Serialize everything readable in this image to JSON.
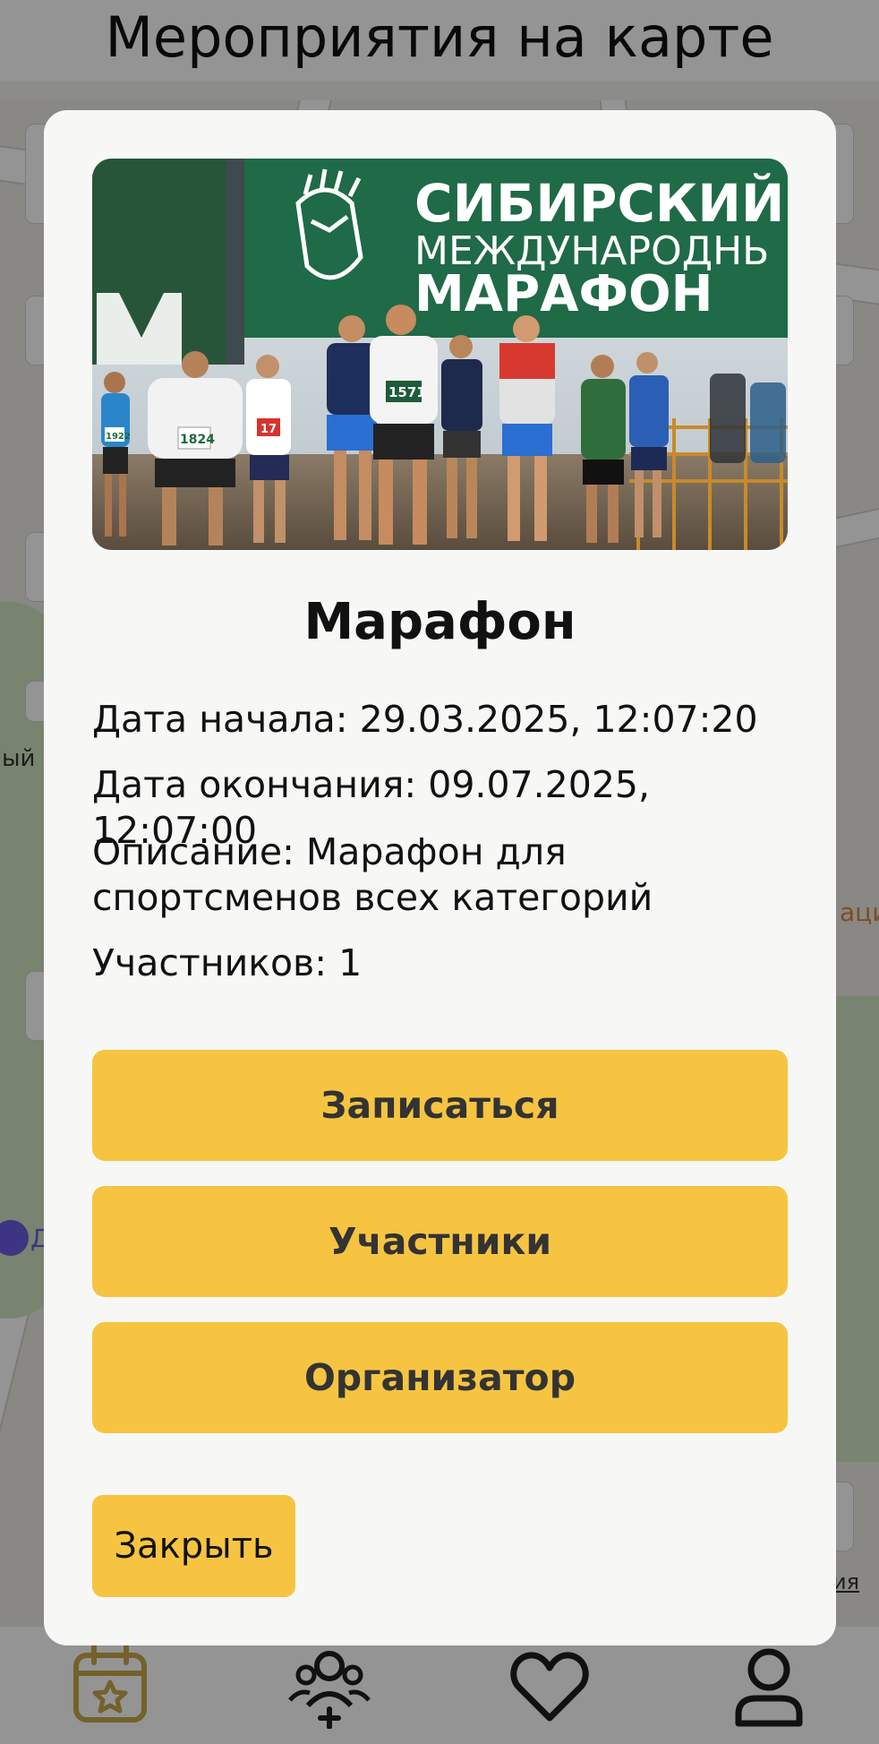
{
  "screen": {
    "title": "Мероприятия на карте"
  },
  "map": {
    "labels": {
      "left_fragment": "ый",
      "right_fragment": "аци",
      "poi_fragment": "Д",
      "link_fragment": "ия"
    }
  },
  "modal": {
    "image": {
      "banner_line1": "СИБИРСКИЙ",
      "banner_line2": "МЕЖДУНАРОДНЬ",
      "banner_line3": "МАРАФОН",
      "bibs": [
        "1922",
        "1824",
        "17",
        "1571"
      ]
    },
    "title": "Марафон",
    "start_label": "Дата начала: 29.03.2025, 12:07:20",
    "end_label": "Дата окончания: 09.07.2025, 12:07:00",
    "description": "Описание: Марафон для спортсменов всех категорий",
    "participants_count": "Участников: 1",
    "buttons": {
      "signup": "Записаться",
      "participants": "Участники",
      "organizer": "Организатор",
      "close": "Закрыть"
    }
  },
  "bottom_nav": {
    "items": [
      {
        "icon": "calendar-star-icon",
        "active": true
      },
      {
        "icon": "people-add-icon",
        "active": false
      },
      {
        "icon": "heart-icon",
        "active": false
      },
      {
        "icon": "profile-icon",
        "active": false
      }
    ]
  },
  "colors": {
    "accent": "#f6c441",
    "nav_active": "#c9a84a",
    "nav_inactive": "#1e1e1e",
    "modal_bg": "#f7f7f5"
  }
}
